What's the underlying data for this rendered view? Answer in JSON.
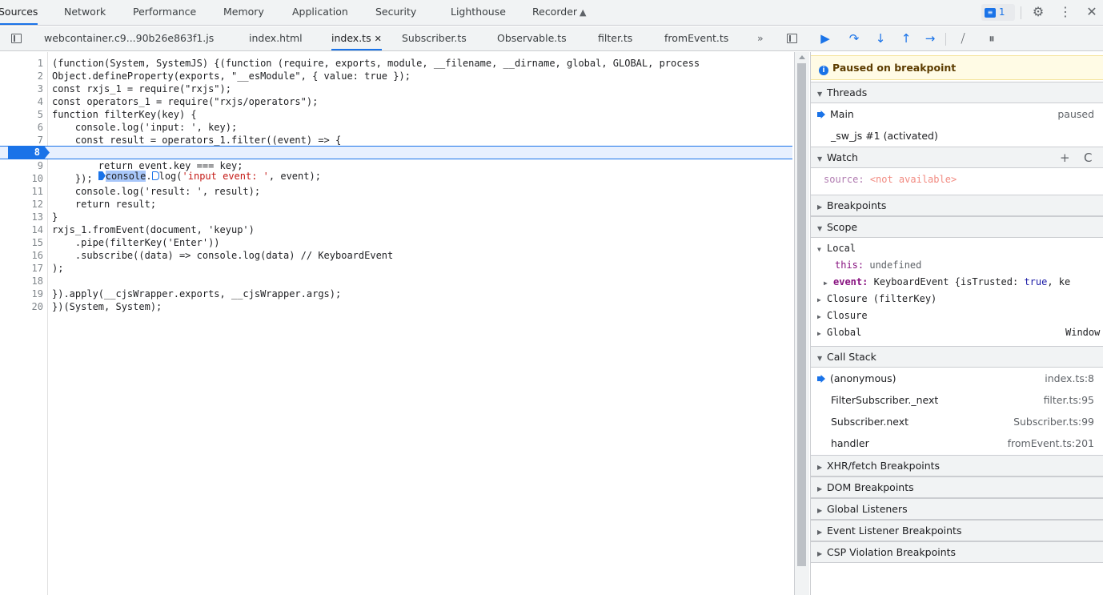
{
  "top_tabs": {
    "sources": "Sources",
    "network": "Network",
    "performance": "Performance",
    "memory": "Memory",
    "application": "Application",
    "security": "Security",
    "lighthouse": "Lighthouse",
    "recorder": "Recorder"
  },
  "issues_count": "1",
  "file_tabs": {
    "webcontainer": "webcontainer.c9...90b26e863f1.js",
    "index_html": "index.html",
    "index_ts": "index.ts",
    "subscriber": "Subscriber.ts",
    "observable": "Observable.ts",
    "filter": "filter.ts",
    "fromevent": "fromEvent.ts",
    "more": "»"
  },
  "code": {
    "l1": "(function(System, SystemJS) {(function (require, exports, module, __filename, __dirname, global, GLOBAL, process",
    "l2": "Object.defineProperty(exports, \"__esModule\", { value: true });",
    "l3": "const rxjs_1 = require(\"rxjs\");",
    "l4": "const operators_1 = require(\"rxjs/operators\");",
    "l5": "function filterKey(key) {",
    "l6": "    console.log('input: ', key);",
    "l7": "    const result = operators_1.filter((event) => {",
    "l8a": "        ",
    "l8b": "console",
    "l8c": ".",
    "l8d": "log(",
    "l8e": "'input event: '",
    "l8f": ", event);",
    "l9": "        return event.key === key;",
    "l10": "    });",
    "l11": "    console.log('result: ', result);",
    "l12": "    return result;",
    "l13": "}",
    "l14": "rxjs_1.fromEvent(document, 'keyup')",
    "l15": "    .pipe(filterKey('Enter'))",
    "l16": "    .subscribe((data) => console.log(data) // KeyboardEvent",
    "l17": ");",
    "l18": "",
    "l19": "}).apply(__cjsWrapper.exports, __cjsWrapper.args);",
    "l20": "})(System, System);"
  },
  "line_numbers": [
    "1",
    "2",
    "3",
    "4",
    "5",
    "6",
    "7",
    "8",
    "9",
    "10",
    "11",
    "12",
    "13",
    "14",
    "15",
    "16",
    "17",
    "18",
    "19",
    "20"
  ],
  "debugger": {
    "paused": "Paused on breakpoint",
    "threads_title": "Threads",
    "thread_main": "Main",
    "thread_main_status": "paused",
    "thread_sw": "_sw_js #1 (activated)",
    "watch_title": "Watch",
    "watch_expr": "source:",
    "watch_value": "<not available>",
    "breakpoints_title": "Breakpoints",
    "scope_title": "Scope",
    "scope_local": "Local",
    "scope_this_key": "this:",
    "scope_this_val": "undefined",
    "scope_event_key": "event:",
    "scope_event_type": "KeyboardEvent {isTrusted:",
    "scope_event_bool": "true",
    "scope_event_rest": ", ke",
    "scope_closure_filterkey": "Closure (filterKey)",
    "scope_closure": "Closure",
    "scope_global": "Global",
    "scope_global_val": "Window",
    "callstack_title": "Call Stack",
    "frames": [
      {
        "name": "(anonymous)",
        "loc": "index.ts:8"
      },
      {
        "name": "FilterSubscriber._next",
        "loc": "filter.ts:95"
      },
      {
        "name": "Subscriber.next",
        "loc": "Subscriber.ts:99"
      },
      {
        "name": "handler",
        "loc": "fromEvent.ts:201"
      }
    ],
    "xhr_title": "XHR/fetch Breakpoints",
    "dom_title": "DOM Breakpoints",
    "global_listeners_title": "Global Listeners",
    "event_listener_title": "Event Listener Breakpoints",
    "csp_title": "CSP Violation Breakpoints"
  },
  "colors": {
    "accent": "#1a73e8",
    "keyword": "#881280",
    "string": "#c41a16",
    "comment": "#236e25",
    "paused_banner": "#fffbe5"
  }
}
